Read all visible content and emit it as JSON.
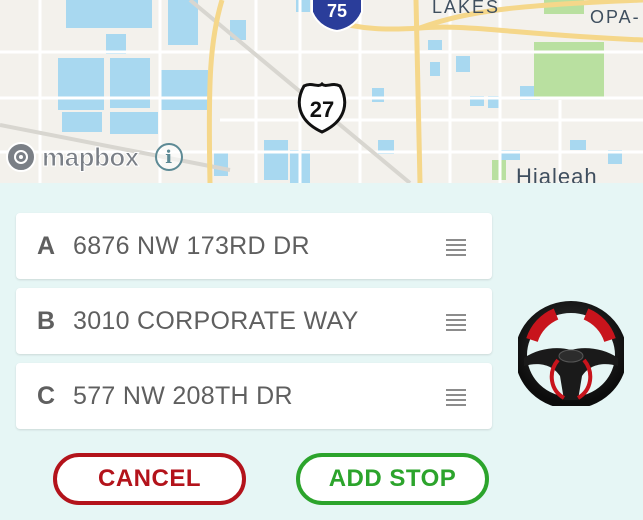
{
  "map": {
    "labels": {
      "lakes": "LAKES",
      "opa": "OPA-",
      "city": "Hialeah"
    },
    "shields": {
      "interstate": "75",
      "us_route": "27"
    },
    "attribution": {
      "brand": "mapbox",
      "info": "i"
    },
    "colors": {
      "water": "#a8d8f0",
      "road": "#f5d78a",
      "park": "#b9e0a0"
    }
  },
  "stops": [
    {
      "letter": "A",
      "address": "6876 NW 173RD DR"
    },
    {
      "letter": "B",
      "address": "3010 CORPORATE WAY"
    },
    {
      "letter": "C",
      "address": "577 NW 208TH DR"
    }
  ],
  "actions": {
    "cancel_label": "CANCEL",
    "add_stop_label": "ADD STOP"
  },
  "icons": {
    "drag": "drag-handle-icon",
    "wheel": "steering-wheel-icon"
  },
  "colors": {
    "background": "#e6f6f5",
    "cancel": "#b3131b",
    "add_stop": "#2ca42c"
  }
}
